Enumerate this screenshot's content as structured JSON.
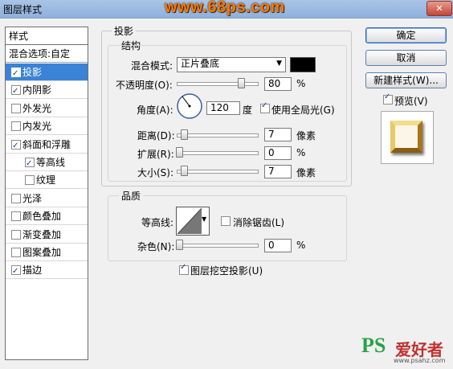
{
  "window": {
    "title": "图层样式",
    "watermark": "www.68ps.com"
  },
  "styles": {
    "header": "样式",
    "blend_options": "混合选项:自定",
    "items": [
      {
        "label": "投影",
        "checked": true,
        "selected": true
      },
      {
        "label": "内阴影",
        "checked": true
      },
      {
        "label": "外发光",
        "checked": false
      },
      {
        "label": "内发光",
        "checked": false
      },
      {
        "label": "斜面和浮雕",
        "checked": true
      },
      {
        "label": "等高线",
        "checked": true,
        "sub": true
      },
      {
        "label": "纹理",
        "checked": false,
        "sub": true
      },
      {
        "label": "光泽",
        "checked": false
      },
      {
        "label": "颜色叠加",
        "checked": false
      },
      {
        "label": "渐变叠加",
        "checked": false
      },
      {
        "label": "图案叠加",
        "checked": false
      },
      {
        "label": "描边",
        "checked": true
      }
    ]
  },
  "drop_shadow": {
    "title": "投影",
    "structure": {
      "title": "结构",
      "blend_mode_label": "混合模式:",
      "blend_mode_value": "正片叠底",
      "blend_color": "#000000",
      "opacity_label": "不透明度(O):",
      "opacity_value": "80",
      "opacity_unit": "%",
      "angle_label": "角度(A):",
      "angle_value": "120",
      "angle_unit": "度",
      "global_light_label": "使用全局光(G)",
      "global_light_checked": true,
      "distance_label": "距离(D):",
      "distance_value": "7",
      "distance_unit": "像素",
      "spread_label": "扩展(R):",
      "spread_value": "0",
      "spread_unit": "%",
      "size_label": "大小(S):",
      "size_value": "7",
      "size_unit": "像素"
    },
    "quality": {
      "title": "品质",
      "contour_label": "等高线:",
      "antialias_label": "消除锯齿(L)",
      "antialias_checked": false,
      "noise_label": "杂色(N):",
      "noise_value": "0",
      "noise_unit": "%"
    },
    "knockout_label": "图层挖空投影(U)",
    "knockout_checked": true
  },
  "buttons": {
    "ok": "确定",
    "cancel": "取消",
    "new_style": "新建样式(W)...",
    "preview_label": "预览(V)",
    "preview_checked": true
  },
  "footer_watermark": {
    "logo": "PS",
    "text": "爱好者",
    "url": "www.psahz.com"
  }
}
